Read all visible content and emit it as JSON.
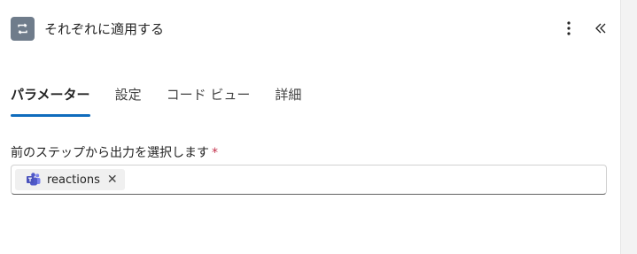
{
  "header": {
    "title": "それぞれに適用する",
    "action_icon": "loop-icon",
    "more_icon": "more-vertical-icon",
    "collapse_icon": "chevron-double-left-icon"
  },
  "tabs": [
    {
      "label": "パラメーター",
      "active": true
    },
    {
      "label": "設定",
      "active": false
    },
    {
      "label": "コード ビュー",
      "active": false
    },
    {
      "label": "詳細",
      "active": false
    }
  ],
  "field": {
    "label": "前のステップから出力を選択します",
    "required_marker": "*",
    "tokens": [
      {
        "label": "reactions",
        "icon": "teams-icon",
        "remove_glyph": "✕"
      }
    ]
  },
  "colors": {
    "accent": "#0f6cbd",
    "action_icon_bg": "#6f7c8b",
    "required": "#c4314b",
    "teams": "#5059c9"
  }
}
